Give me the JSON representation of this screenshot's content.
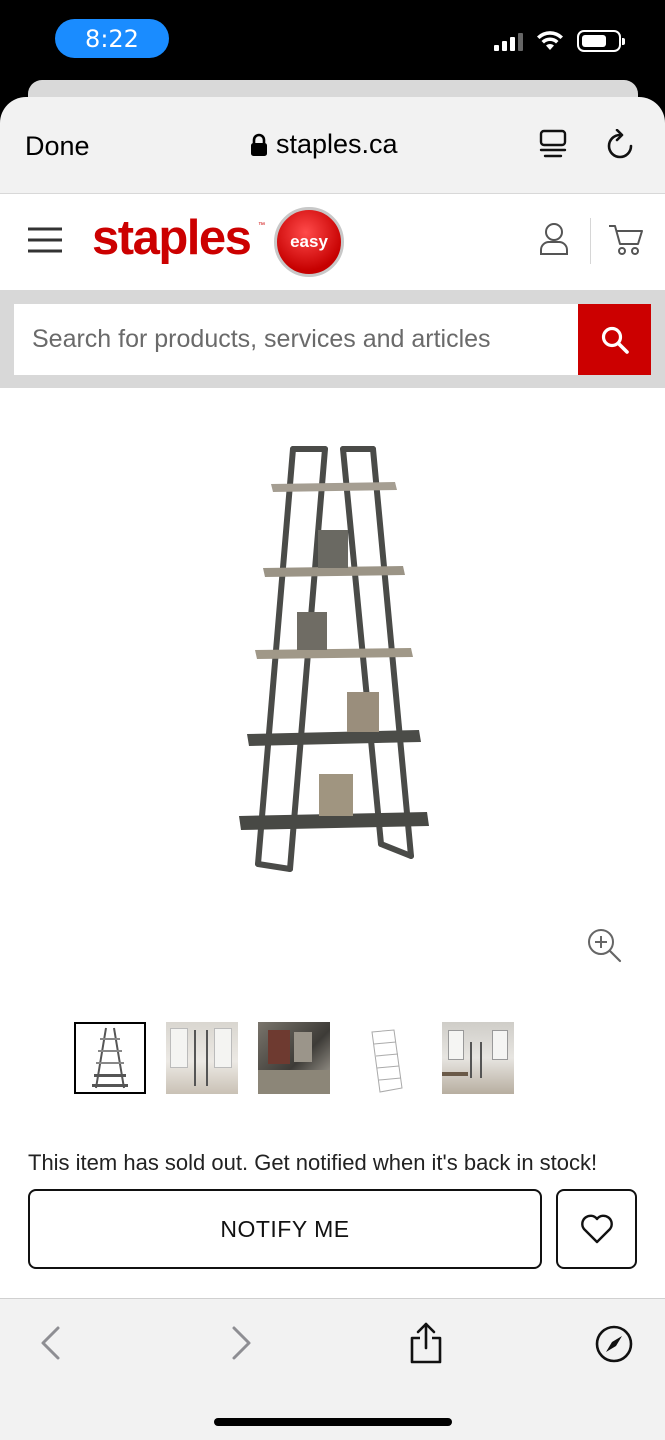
{
  "status_bar": {
    "time": "8:22"
  },
  "safari": {
    "done_label": "Done",
    "url": "staples.ca",
    "icons": [
      "lock-icon",
      "reader-icon",
      "reload-icon"
    ]
  },
  "header": {
    "logo_text": "staples",
    "logo_tm": "™",
    "easy_button": "easy",
    "icons": [
      "hamburger-icon",
      "account-icon",
      "cart-icon"
    ]
  },
  "search": {
    "placeholder": "Search for products, services and articles"
  },
  "product": {
    "sold_out_message": "This item has sold out. Get notified when it's back in stock!",
    "notify_label": "NOTIFY ME",
    "thumbnail_count": 5
  },
  "bottom_toolbar": {
    "icons": [
      "back-icon",
      "forward-icon",
      "share-icon",
      "compass-icon"
    ]
  },
  "colors": {
    "brand_red": "#cc0000",
    "time_pill": "#1a8cff"
  }
}
